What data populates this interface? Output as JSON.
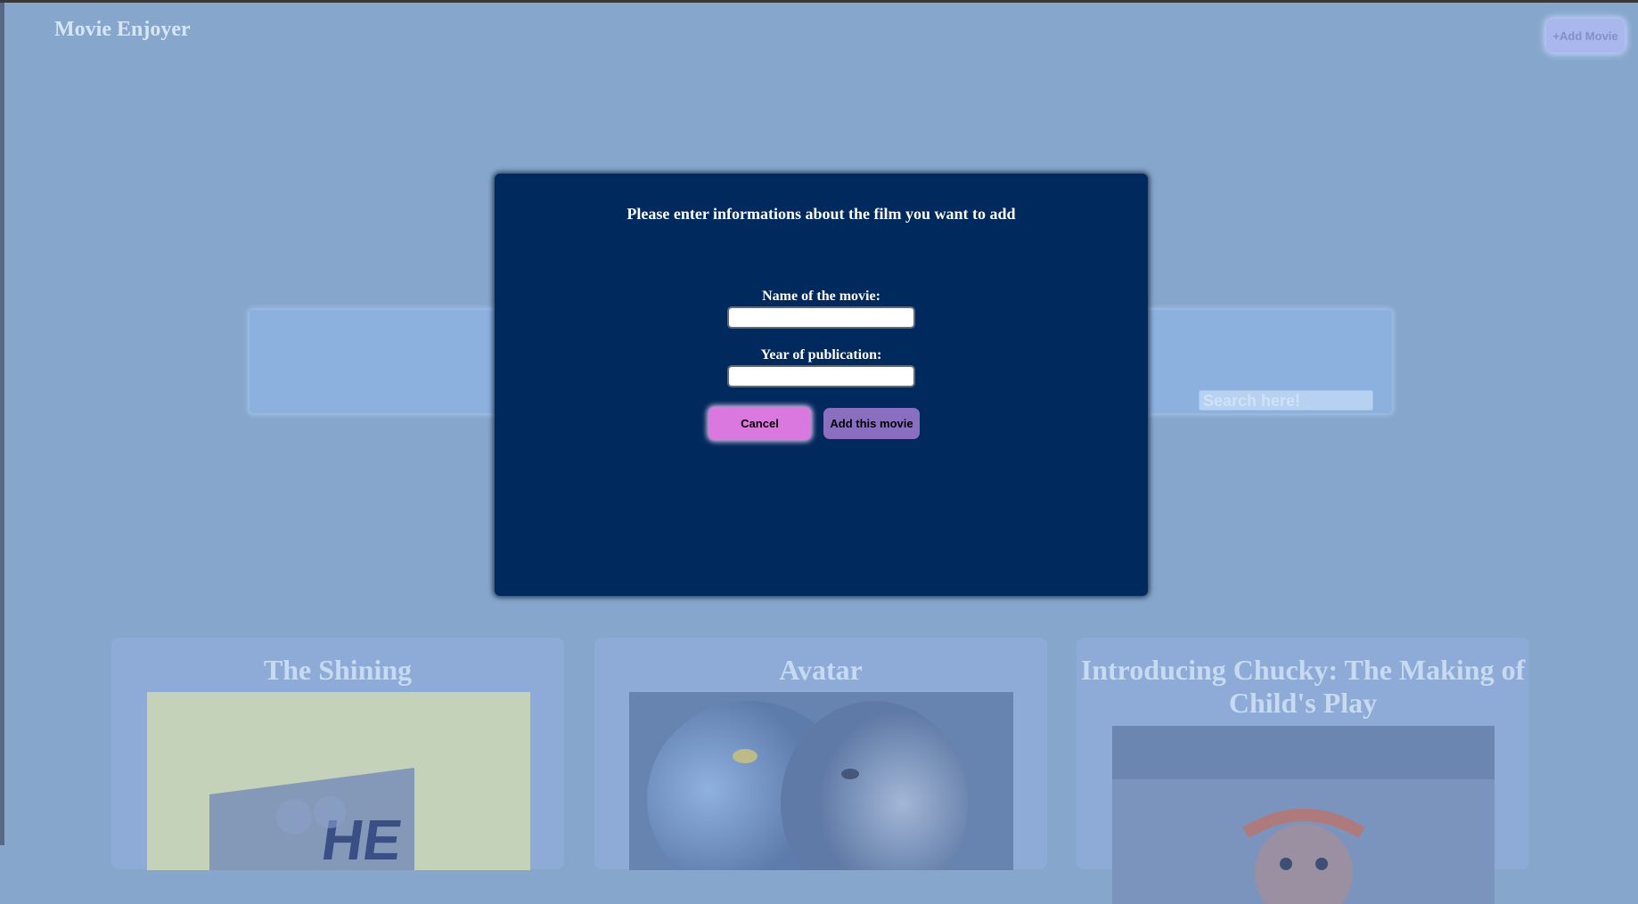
{
  "header": {
    "app_title": "Movie Enjoyer",
    "add_movie_label": "+Add Movie"
  },
  "search": {
    "placeholder": "Search here!"
  },
  "movies": [
    {
      "title": "The Shining"
    },
    {
      "title": "Avatar"
    },
    {
      "title": "Introducing Chucky: The Making of Child's Play"
    }
  ],
  "modal": {
    "title": "Please enter informations about the film you want to add",
    "name_label": "Name of the movie:",
    "name_value": "",
    "year_label": "Year of publication:",
    "year_value": "",
    "cancel_label": "Cancel",
    "submit_label": "Add this movie"
  },
  "colors": {
    "page_background": "#86a6cb",
    "modal_background": "#002a5e",
    "cancel_button": "#da78e0",
    "submit_button": "#8a6fc0"
  }
}
